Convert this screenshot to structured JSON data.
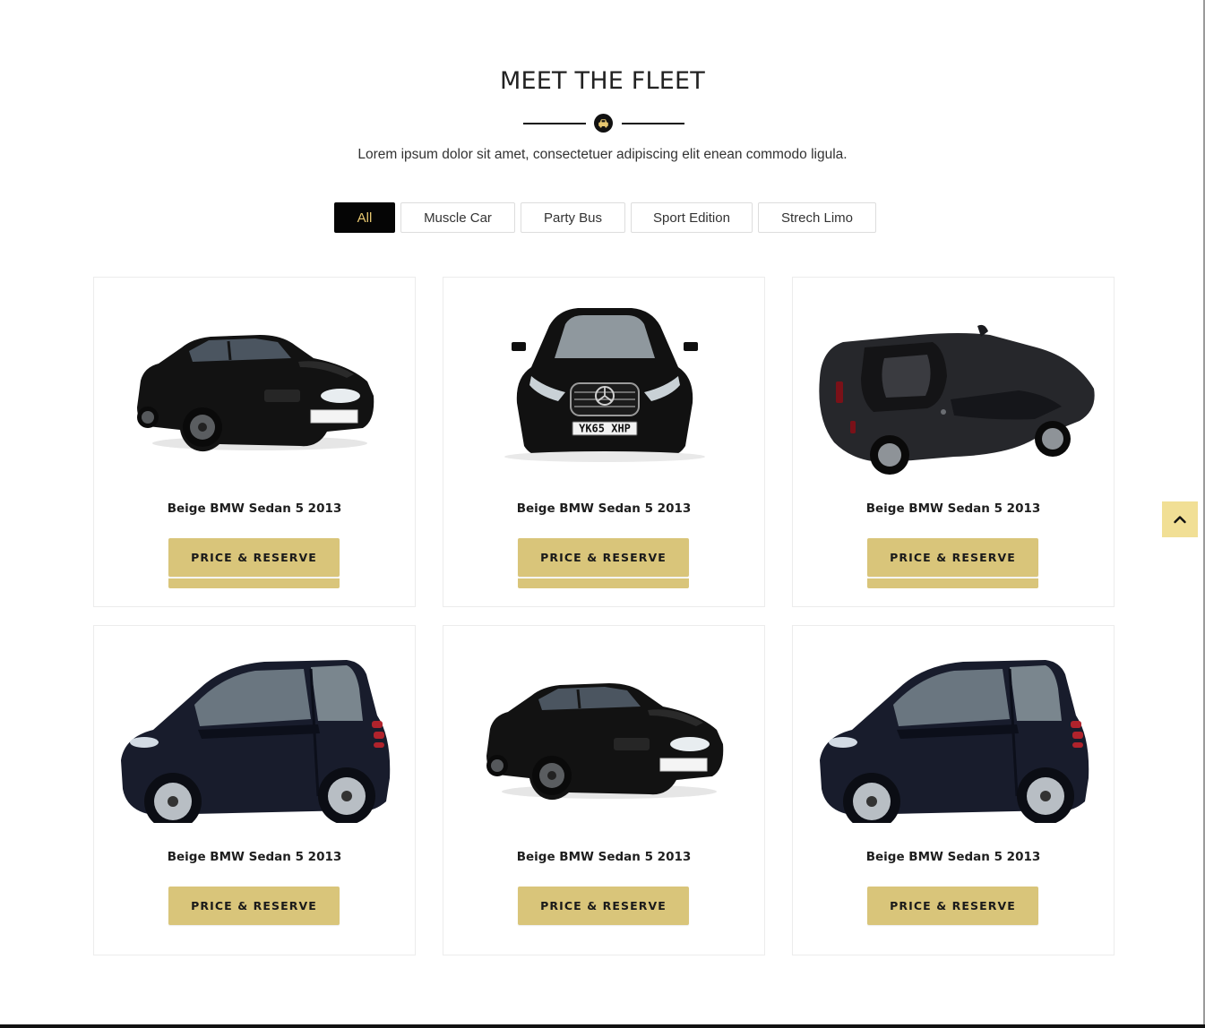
{
  "section": {
    "title": "MEET THE FLEET",
    "subtitle": "Lorem ipsum dolor sit amet, consectetuer adipiscing elit enean commodo ligula."
  },
  "filters": {
    "items": [
      {
        "label": "All"
      },
      {
        "label": "Muscle Car"
      },
      {
        "label": "Party Bus"
      },
      {
        "label": "Sport Edition"
      },
      {
        "label": "Strech Limo"
      }
    ],
    "active_index": 0
  },
  "cars": [
    {
      "name": "Beige BMW Sedan 5 2013",
      "button_label": "PRICE & RESERVE",
      "image_icon": "sedan-side-icon"
    },
    {
      "name": "Beige BMW Sedan 5 2013",
      "button_label": "PRICE & RESERVE",
      "image_icon": "sedan-front-icon",
      "plate": "YK65 XHP"
    },
    {
      "name": "Beige BMW Sedan 5 2013",
      "button_label": "PRICE & RESERVE",
      "image_icon": "sports-car-top-icon"
    },
    {
      "name": "Beige BMW Sedan 5 2013",
      "button_label": "PRICE & RESERVE",
      "image_icon": "city-car-icon"
    },
    {
      "name": "Beige BMW Sedan 5 2013",
      "button_label": "PRICE & RESERVE",
      "image_icon": "sedan-side-icon"
    },
    {
      "name": "Beige BMW Sedan 5 2013",
      "button_label": "PRICE & RESERVE",
      "image_icon": "city-car-icon"
    }
  ],
  "colors": {
    "accent": "#d9c57a",
    "active_tab_bg": "#050505",
    "active_tab_text": "#e7c770",
    "back_to_top_bg": "#f1df95"
  },
  "back_to_top": {
    "icon": "chevron-up-icon"
  }
}
